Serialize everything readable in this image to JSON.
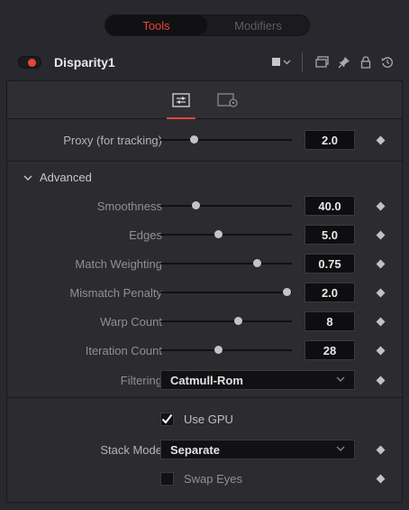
{
  "tabs": {
    "tools": "Tools",
    "modifiers": "Modifiers"
  },
  "tool": {
    "name": "Disparity1"
  },
  "proxy": {
    "label": "Proxy (for tracking)",
    "value": "2.0",
    "fraction": 0.25
  },
  "advanced": {
    "header": "Advanced",
    "params": [
      {
        "label": "Smoothness",
        "value": "40.0",
        "fraction": 0.27
      },
      {
        "label": "Edges",
        "value": "5.0",
        "fraction": 0.44
      },
      {
        "label": "Match Weighting",
        "value": "0.75",
        "fraction": 0.73
      },
      {
        "label": "Mismatch Penalty",
        "value": "2.0",
        "fraction": 0.96
      },
      {
        "label": "Warp Count",
        "value": "8",
        "fraction": 0.59
      },
      {
        "label": "Iteration Count",
        "value": "28",
        "fraction": 0.44
      }
    ],
    "filtering": {
      "label": "Filtering",
      "value": "Catmull-Rom"
    }
  },
  "gpu": {
    "label": "Use GPU",
    "checked": true
  },
  "stack": {
    "label": "Stack Mode",
    "value": "Separate"
  },
  "swap": {
    "label": "Swap Eyes",
    "checked": false
  },
  "colors": {
    "accent": "#e7443a",
    "background": "#28282e",
    "panel": "#2b2b30"
  }
}
